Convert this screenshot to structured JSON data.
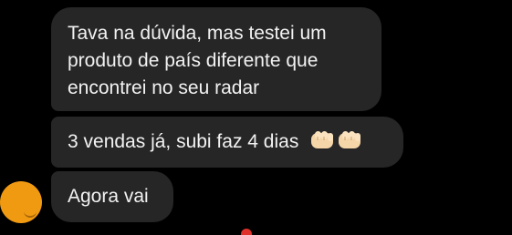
{
  "messages": [
    {
      "lines": [
        "Tava na dúvida, mas testei um",
        "produto de país diferente que",
        "encontrei no seu radar"
      ]
    },
    {
      "text": "3 vendas já, subi faz 4 dias",
      "emoji": "oncoming-fist-emoji x2"
    },
    {
      "text": "Agora vai"
    }
  ],
  "avatar": {
    "icon": "user-avatar-icon",
    "color": "#f09a12"
  },
  "partial_next_message": "",
  "colors": {
    "background": "#000000",
    "bubble": "#262626",
    "text": "#f2f2f2"
  }
}
